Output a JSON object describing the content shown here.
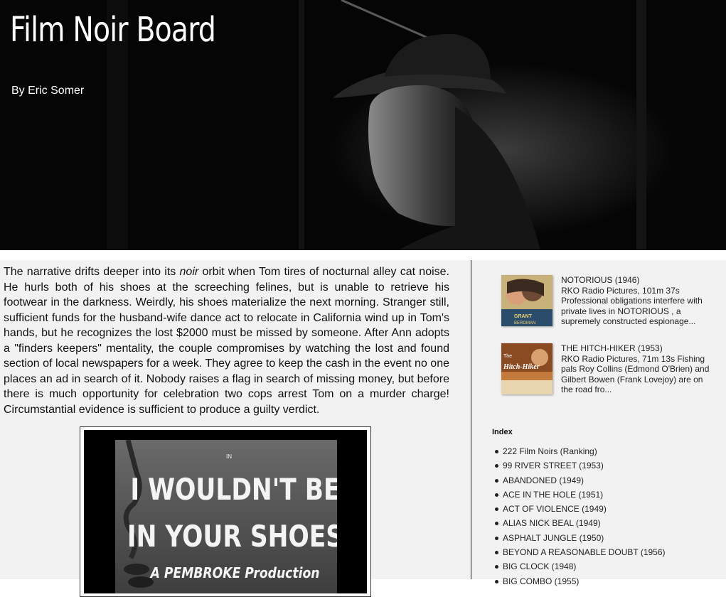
{
  "header": {
    "title": "Film Noir Board",
    "byline": "By Eric Somer"
  },
  "post": {
    "body_parts": [
      "The narrative drifts deeper into its ",
      "noir",
      " orbit when Tom tires of nocturnal alley cat noise. He hurls both of his shoes at the screeching felines, but is unable to retrieve his footwear in the darkness. Weirdly, his shoes materialize the next morning. Stranger still, sufficient funds for the husband-wife dance act to relocate in California wind up in Tom's hands, but he recognizes the lost $2000 must be missed by someone. After Ann adopts a \"finders keepers\" mentality, the couple compromises by watching the lost and found section of local newspapers for a week. They agree to keep the cash in the event no one places an ad in search of it. Nobody raises a flag in search of missing money, but before there is much opportunity for celebration two cops arrest Tom on a murder charge! Circumstantial evidence is sufficient to produce a guilty verdict."
    ],
    "still": {
      "small_text": "IN",
      "line1": "I WOULDN'T BE",
      "line2": "IN YOUR SHOES",
      "line3": "A PEMBROKE Production"
    }
  },
  "sidebar": {
    "popular_posts": [
      {
        "title": "NOTORIOUS (1946)",
        "snippet": "RKO Radio Pictures, 101m 37s Professional obligations interfere with private lives in NOTORIOUS , a supremely constructed espionage...",
        "thumb_text": [
          "GRANT",
          "BERGMAN"
        ]
      },
      {
        "title": "THE HITCH-HIKER (1953)",
        "snippet": "RKO Radio Pictures, 71m 13s Fishing pals Roy Collins (Edmond O'Brien) and Gilbert Bowen (Frank Lovejoy) are on the road fro...",
        "thumb_text": [
          "The",
          "Hitch-Hiker"
        ]
      }
    ],
    "index_heading": "Index",
    "index_items": [
      "222 Film Noirs (Ranking)",
      "99 RIVER STREET (1953)",
      "ABANDONED (1949)",
      "ACE IN THE HOLE (1951)",
      "ACT OF VIOLENCE (1949)",
      "ALIAS NICK BEAL (1949)",
      "ASPHALT JUNGLE (1950)",
      "BEYOND A REASONABLE DOUBT (1956)",
      "BIG CLOCK (1948)",
      "BIG COMBO (1955)"
    ]
  },
  "colors": {
    "page_bg": "#f2f2f2",
    "header_bg": "#050505",
    "text": "#111111"
  }
}
